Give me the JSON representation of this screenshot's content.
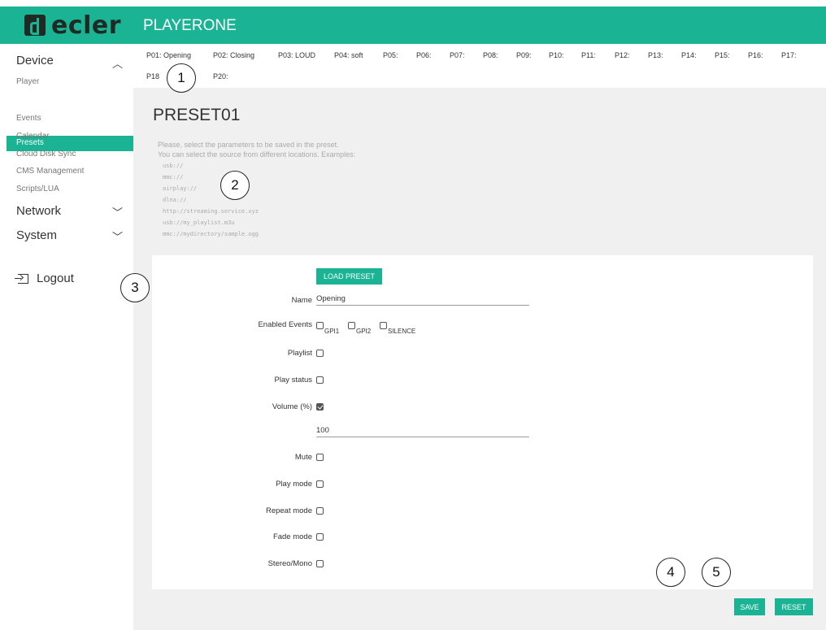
{
  "header": {
    "brand": "ecler",
    "app_title": "PLAYERONE"
  },
  "sidebar": {
    "device": "Device",
    "items": [
      "Player",
      "Presets",
      "Events",
      "Calendar",
      "Cloud Disk Sync",
      "CMS Management",
      "Scripts/LUA"
    ],
    "network": "Network",
    "system": "System",
    "logout": "Logout"
  },
  "tabs": [
    "P01: Opening",
    "P02: Closing",
    "P03: LOUD",
    "P04: soft",
    "P05:",
    "P06:",
    "P07:",
    "P08:",
    "P09:",
    "P10:",
    "P11:",
    "P12:",
    "P13:",
    "P14:",
    "P15:",
    "P16:",
    "P17:",
    "P18",
    "P20:"
  ],
  "callouts": [
    "1",
    "2",
    "3",
    "4",
    "5"
  ],
  "preset": {
    "title": "PRESET01",
    "help_line1": "Please, select the parameters to be saved in the preset.",
    "help_line2": "You can select the source from different locations. Examples:",
    "examples": [
      "usb://",
      "mmc://",
      "airplay://",
      "dlna://",
      "http://streaming.service.xyz",
      "usb://my_playlist.m3u",
      "mmc://mydirectory/sample.ogg"
    ]
  },
  "form": {
    "load_preset": "LOAD PRESET",
    "name_label": "Name",
    "name_value": "Opening",
    "enabled_events_label": "Enabled Events",
    "events": [
      "GPI1",
      "GPI2",
      "SILENCE"
    ],
    "playlist_label": "Playlist",
    "play_status_label": "Play status",
    "volume_label": "Volume (%)",
    "volume_checked": true,
    "volume_value": "100",
    "mute_label": "Mute",
    "play_mode_label": "Play mode",
    "repeat_mode_label": "Repeat mode",
    "fade_mode_label": "Fade mode",
    "stereo_mono_label": "Stereo/Mono"
  },
  "actions": {
    "save": "SAVE",
    "reset": "RESET"
  }
}
